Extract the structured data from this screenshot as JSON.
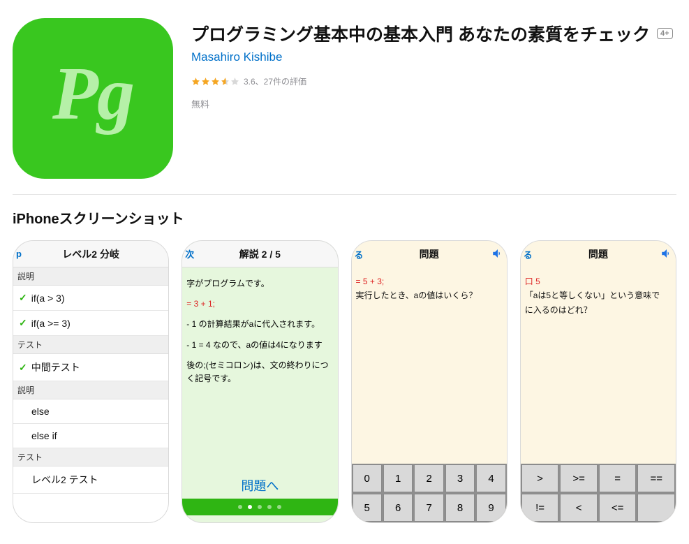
{
  "app": {
    "icon_text": "Pg",
    "title": "プログラミング基本中の基本入門 あなたの素質をチェック",
    "age_badge": "4+",
    "developer": "Masahiro Kishibe",
    "rating_value": 3.6,
    "rating_text": "3.6、27件の評価",
    "price": "無料"
  },
  "section_title": "iPhoneスクリーンショット",
  "screenshots": {
    "s1": {
      "nav_left": "p",
      "nav_title": "レベル2 分岐",
      "sections": [
        {
          "header": "説明",
          "rows": [
            {
              "checked": true,
              "text": "if(a > 3)"
            },
            {
              "checked": true,
              "text": "if(a >= 3)"
            }
          ]
        },
        {
          "header": "テスト",
          "rows": [
            {
              "checked": true,
              "text": "中間テスト"
            }
          ]
        },
        {
          "header": "説明",
          "rows": [
            {
              "checked": false,
              "text": "else"
            },
            {
              "checked": false,
              "text": "else if"
            }
          ]
        },
        {
          "header": "テスト",
          "rows": [
            {
              "checked": false,
              "text": "レベル2 テスト"
            }
          ]
        }
      ]
    },
    "s2": {
      "nav_left": "次",
      "nav_title": "解説 2 / 5",
      "line_intro": "字がプログラムです。",
      "line_expr": "= 3 + 1;",
      "line_calc": "- 1 の計算結果がaに代入されます。",
      "line_result": "- 1 = 4 なので、aの値は4になります",
      "line_semicolon": "後の;(セミコロン)は、文の終わりにつく記号です。",
      "go_problem": "問題へ",
      "page_dots_total": 5,
      "page_dots_active": 2
    },
    "s3": {
      "nav_left": "る",
      "nav_title": "問題",
      "line_expr": "= 5 + 3;",
      "line_q": "実行したとき、aの値はいくら？",
      "keys": [
        "0",
        "1",
        "2",
        "3",
        "4",
        "5",
        "6",
        "7",
        "8",
        "9"
      ]
    },
    "s4": {
      "nav_left": "る",
      "nav_title": "問題",
      "line_title": "口 5",
      "line_q1": "「aは5と等しくない」という意味で",
      "line_q2": "に入るのはどれ？",
      "keys": [
        ">",
        ">=",
        "=",
        "==",
        "!=",
        "<",
        "<=",
        ""
      ]
    }
  }
}
